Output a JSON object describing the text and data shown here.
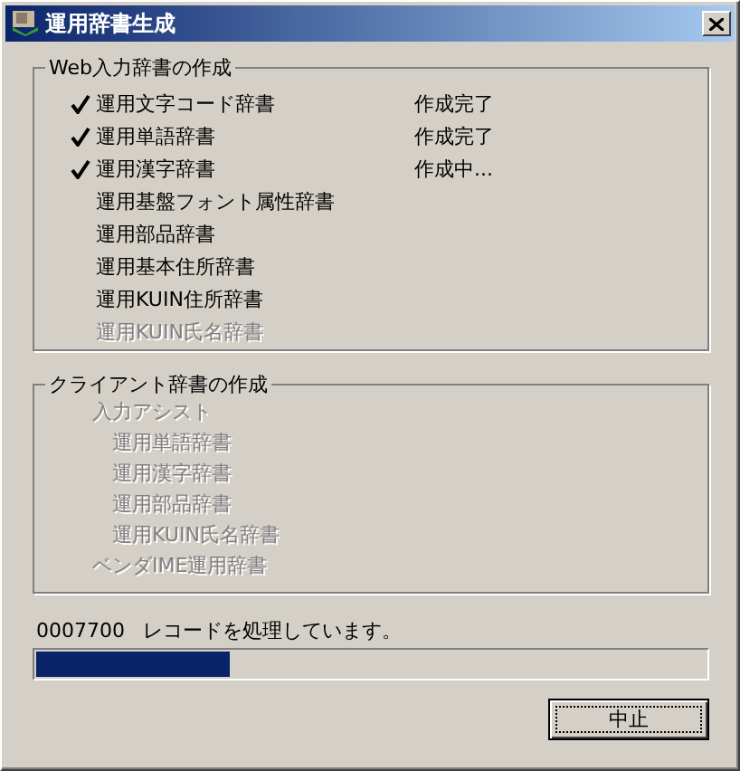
{
  "window": {
    "title": "運用辞書生成"
  },
  "web_group": {
    "title": "Web入力辞書の作成",
    "items": [
      {
        "label": "運用文字コード辞書",
        "checked": true,
        "status": "作成完了",
        "disabled": false
      },
      {
        "label": "運用単語辞書",
        "checked": true,
        "status": "作成完了",
        "disabled": false
      },
      {
        "label": "運用漢字辞書",
        "checked": true,
        "status": "作成中...",
        "disabled": false
      },
      {
        "label": "運用基盤フォント属性辞書",
        "checked": false,
        "disabled": false
      },
      {
        "label": "運用部品辞書",
        "checked": false,
        "disabled": false
      },
      {
        "label": "運用基本住所辞書",
        "checked": false,
        "disabled": false
      },
      {
        "label": "運用KUIN住所辞書",
        "checked": false,
        "disabled": false
      },
      {
        "label": "運用KUIN氏名辞書",
        "checked": false,
        "disabled": true
      }
    ]
  },
  "client_group": {
    "title": "クライアント辞書の作成",
    "items": [
      {
        "label": "入力アシスト",
        "disabled": true,
        "children": [
          {
            "label": "運用単語辞書",
            "disabled": true
          },
          {
            "label": "運用漢字辞書",
            "disabled": true
          },
          {
            "label": "運用部品辞書",
            "disabled": true
          },
          {
            "label": "運用KUIN氏名辞書",
            "disabled": true
          }
        ]
      },
      {
        "label": "ベンダIME運用辞書",
        "disabled": true
      }
    ]
  },
  "progress": {
    "count": "0007700",
    "message": "レコードを処理しています。",
    "level": 0.29
  },
  "buttons": [
    "中止"
  ]
}
